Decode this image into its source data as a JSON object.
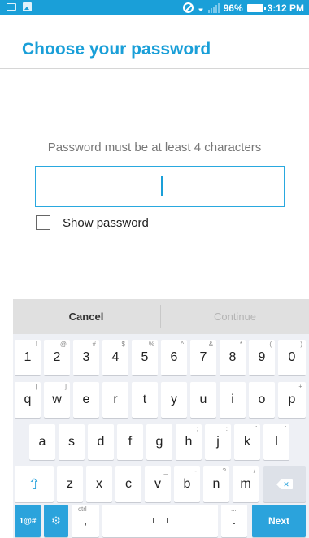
{
  "status_bar": {
    "battery": "96%",
    "time": "3:12 PM",
    "icons": [
      "keyboard-icon",
      "image-icon",
      "do-not-disturb-icon",
      "wifi-icon",
      "signal-icon",
      "battery-icon"
    ]
  },
  "header": {
    "title": "Choose your password"
  },
  "form": {
    "hint": "Password must be at least 4 characters",
    "password_value": "",
    "show_password_label": "Show password",
    "show_password_checked": false
  },
  "actions": {
    "cancel": "Cancel",
    "continue": "Continue"
  },
  "keyboard": {
    "row1": [
      {
        "k": "1",
        "h": "!"
      },
      {
        "k": "2",
        "h": "@"
      },
      {
        "k": "3",
        "h": "#"
      },
      {
        "k": "4",
        "h": "$"
      },
      {
        "k": "5",
        "h": "%"
      },
      {
        "k": "6",
        "h": "^"
      },
      {
        "k": "7",
        "h": "&"
      },
      {
        "k": "8",
        "h": "*"
      },
      {
        "k": "9",
        "h": "("
      },
      {
        "k": "0",
        "h": ")"
      }
    ],
    "row2": [
      {
        "k": "q",
        "h": "["
      },
      {
        "k": "w",
        "h": "]"
      },
      {
        "k": "e",
        "h": ""
      },
      {
        "k": "r",
        "h": ""
      },
      {
        "k": "t",
        "h": ""
      },
      {
        "k": "y",
        "h": ""
      },
      {
        "k": "u",
        "h": ""
      },
      {
        "k": "i",
        "h": ""
      },
      {
        "k": "o",
        "h": ""
      },
      {
        "k": "p",
        "h": "+"
      }
    ],
    "row3": [
      {
        "k": "a",
        "h": ""
      },
      {
        "k": "s",
        "h": ""
      },
      {
        "k": "d",
        "h": ""
      },
      {
        "k": "f",
        "h": ""
      },
      {
        "k": "g",
        "h": ""
      },
      {
        "k": "h",
        "h": ";"
      },
      {
        "k": "j",
        "h": ":"
      },
      {
        "k": "k",
        "h": "\""
      },
      {
        "k": "l",
        "h": "'"
      }
    ],
    "row4": [
      {
        "k": "z",
        "h": ""
      },
      {
        "k": "x",
        "h": ""
      },
      {
        "k": "c",
        "h": ""
      },
      {
        "k": "v",
        "h": "_"
      },
      {
        "k": "b",
        "h": "-"
      },
      {
        "k": "n",
        "h": "?"
      },
      {
        "k": "m",
        "h": "/"
      }
    ],
    "symbols_label": "1@#",
    "comma": ",",
    "comma_hint": "ctrl",
    "period": ".",
    "period_hint": "...",
    "next_label": "Next"
  },
  "colors": {
    "accent": "#1a9fd8",
    "keyboard_bg": "#eef0f5",
    "action_bar": "#e0e0e0"
  }
}
